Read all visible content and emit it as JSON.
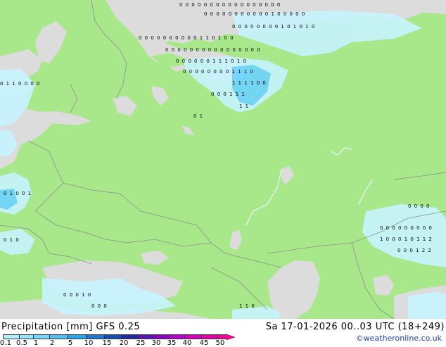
{
  "title": "Precipitation [mm]  GFS 0.25",
  "validity": "Sa 17-01-2026 00..03 UTC (18+249)",
  "credit": "©weatheronline.co.uk",
  "colors": {
    "land": "#a9e88a",
    "sea": "#dcdcdc",
    "precip_light": "#c8f4ff",
    "precip_mid": "#6fd4ff",
    "border": "#8c8c8c"
  },
  "legend": {
    "labels": [
      "0.1",
      "0.5",
      "1",
      "2",
      "5",
      "10",
      "15",
      "20",
      "25",
      "30",
      "35",
      "40",
      "45",
      "50"
    ],
    "colors": [
      "#b4f0ff",
      "#96e6ff",
      "#78d6ff",
      "#50c0f4",
      "#2aa4ea",
      "#1e78d2",
      "#1450b4",
      "#1e2ca0",
      "#5a14b4",
      "#8a00c8",
      "#b400d2",
      "#d200be",
      "#e600aa",
      "#f4009a"
    ]
  },
  "grid_values": [
    {
      "row": 1,
      "text": "0  0   0  0  0      0  0  0  0  0  0  0  0  0  0  0  0"
    },
    {
      "row": 2,
      "text": "0  0  0  0  0  0  0  0  0  0  0  1  0  0  0  0  0"
    },
    {
      "row": 3,
      "text": "0  0  0  0  0  0  0  0  1  0  1  0  1  0"
    },
    {
      "row": 4,
      "text": "0   0  0  0  0  0  0  0  0  0  1  1  0  1  0  0"
    },
    {
      "row": 5,
      "text": "0  0  0  0  0  0  0  0  0  0  0  0  0  0  0  0"
    },
    {
      "row": 6,
      "text": "0  0  0  0  0  0  1  1  1  0  1  0"
    },
    {
      "row": 7,
      "text": "0  0  0  0  0  0  0  0  1  1  1  0"
    },
    {
      "row": 8,
      "text": "1  1  1  1  0  0"
    },
    {
      "row": 9,
      "text": "0  0  0  1  1  1"
    },
    {
      "row": 10,
      "text": "1  1"
    },
    {
      "row": 11,
      "text": "0  1"
    },
    {
      "row": 12,
      "text": "0  1  0  0  1"
    },
    {
      "row": 13,
      "text": "0  1  0"
    },
    {
      "row": 14,
      "text": "0  0  0  1  0"
    },
    {
      "row": 15,
      "text": "0  0  0"
    },
    {
      "row": 16,
      "text": "0  0  0  0  0  0  0  0  0"
    },
    {
      "row": 17,
      "text": "1  0  0  0  1  0  1  1  2"
    },
    {
      "row": 18,
      "text": "0  0  0  1  2  2"
    },
    {
      "row": 19,
      "text": "0  0  0  0"
    },
    {
      "row": 20,
      "text": "0  1  1  0  0  0  0"
    },
    {
      "row": 21,
      "text": "1  1  0"
    }
  ]
}
